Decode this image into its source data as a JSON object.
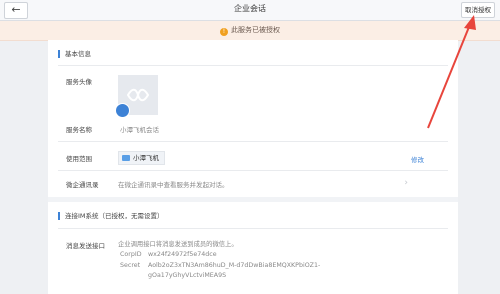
{
  "topbar": {
    "back_icon_glyph": "←",
    "title": "企业会话",
    "revoke_label": "取消授权"
  },
  "notice": {
    "icon_glyph": "!",
    "text": "此服务已被授权"
  },
  "basic": {
    "section_title": "基本信息",
    "avatar_label": "服务头像",
    "name_label": "服务名称",
    "name_value": "小潭飞机会话",
    "scope_label": "使用范围",
    "scope_value": "小潭飞机",
    "scope_edit": "修改",
    "contacts_label": "微企通讯录",
    "contacts_value": "在微企通讯录中查看服务并发起对话。",
    "chevron_glyph": "›"
  },
  "im": {
    "section_title": "连接IM系统（已授权，无需设置）",
    "callback_label": "消息发送接口",
    "callback_desc": "企业调用接口将消息发送到成员的微信上。",
    "corpid_label": "CorpID",
    "corpid_value": "wx24f24972f5e74dce",
    "secret_label": "Secret",
    "secret_line1": "Aolb2oZ3xTN3Am86huD_M-d7dDwBia8EMQXKPbiOZ1-",
    "secret_line2": "gOa17yGhyVLctviMEA9S"
  },
  "colors": {
    "accent": "#3d82d6",
    "notice_bg": "#fbeee5",
    "warning": "#f0a020",
    "annotation_arrow": "#e8453c"
  },
  "icons": [
    "back-arrow-icon",
    "warning-icon",
    "avatar-icon",
    "folder-icon",
    "chevron-right-icon"
  ]
}
